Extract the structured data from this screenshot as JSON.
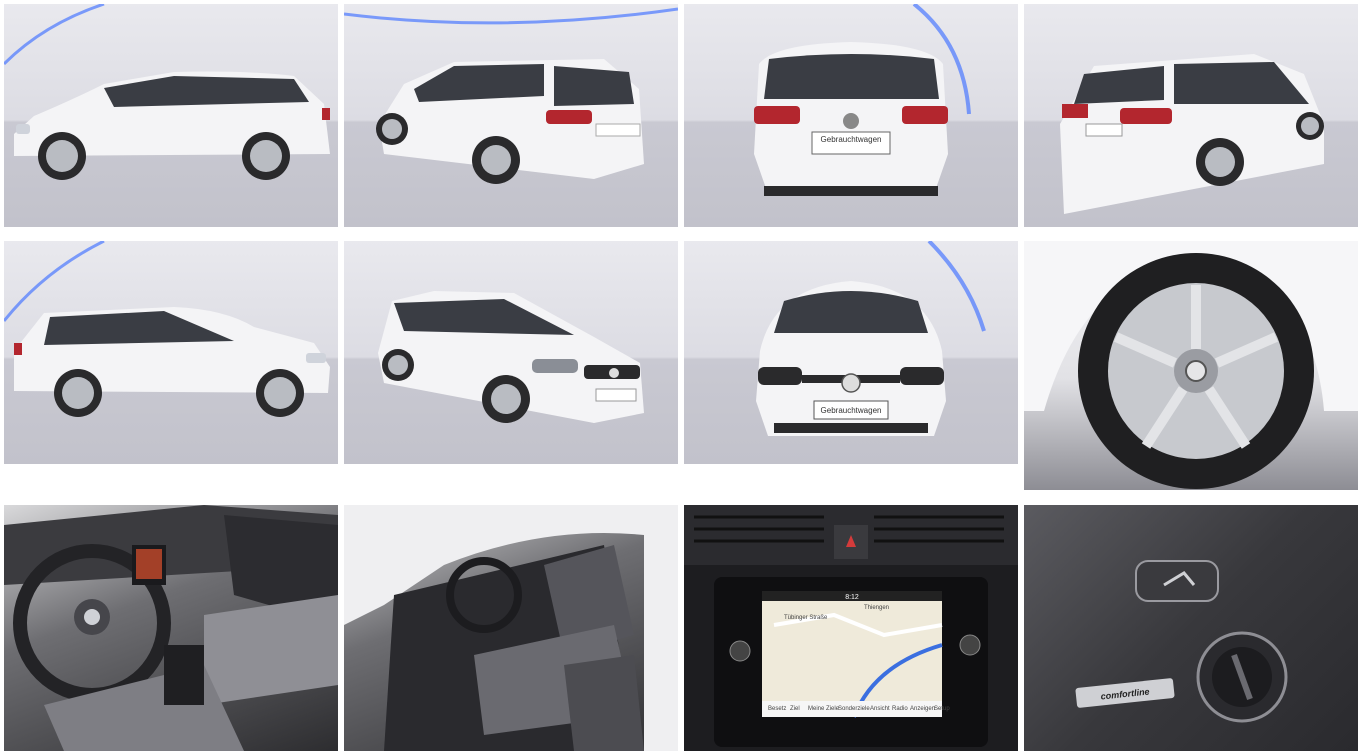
{
  "gallery": {
    "images": [
      {
        "name": "side-left"
      },
      {
        "name": "rear-three-quarter-left"
      },
      {
        "name": "rear"
      },
      {
        "name": "rear-three-quarter-right"
      },
      {
        "name": "side-right"
      },
      {
        "name": "front-three-quarter"
      },
      {
        "name": "front"
      },
      {
        "name": "wheel-closeup"
      },
      {
        "name": "interior-dashboard"
      },
      {
        "name": "interior-seats"
      },
      {
        "name": "infotainment-screen"
      },
      {
        "name": "seat-control-panel"
      }
    ],
    "plate_text": "Gebrauchtwagen",
    "badge_text": "comfortline",
    "nav": {
      "time": "8:12",
      "street": "Tübinger Straße",
      "city": "Thiengen",
      "menu_labels": [
        "Besetz",
        "Ziel",
        "Meine Ziele",
        "Sonderziele",
        "Ansicht",
        "Radio",
        "Anzeigen",
        "Setup"
      ]
    }
  },
  "colors": {
    "car_white": "#f4f4f6",
    "glass": "#3a3d44",
    "tail_light": "#b3262e",
    "accent_blue": "#4a78ff",
    "studio_floor": "#c4c4cd"
  }
}
